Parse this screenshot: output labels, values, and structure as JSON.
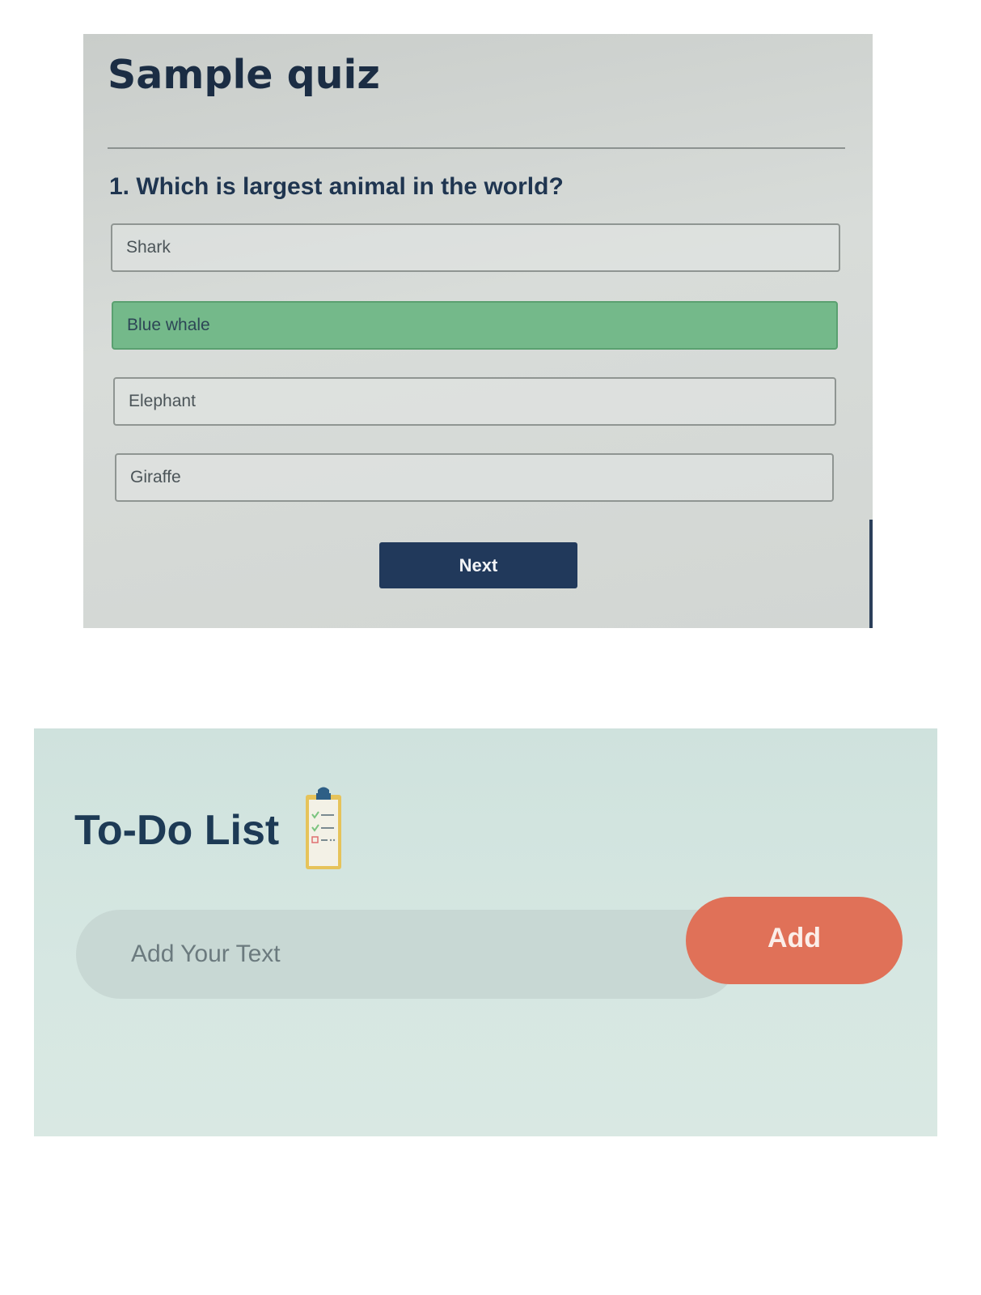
{
  "quiz": {
    "title": "Sample quiz",
    "question": "1. Which is largest animal in the world?",
    "options": [
      {
        "label": "Shark",
        "selected": false
      },
      {
        "label": "Blue whale",
        "selected": true
      },
      {
        "label": "Elephant",
        "selected": false
      },
      {
        "label": "Giraffe",
        "selected": false
      }
    ],
    "next_label": "Next"
  },
  "todo": {
    "title": "To-Do List",
    "title_icon": "clipboard-checklist-icon",
    "input_placeholder": "Add Your Text",
    "add_label": "Add"
  },
  "colors": {
    "quiz_heading": "#1b2d44",
    "selected_option": "#74b98a",
    "next_button": "#21395b",
    "todo_heading": "#1d3a55",
    "add_button": "#e07158"
  }
}
